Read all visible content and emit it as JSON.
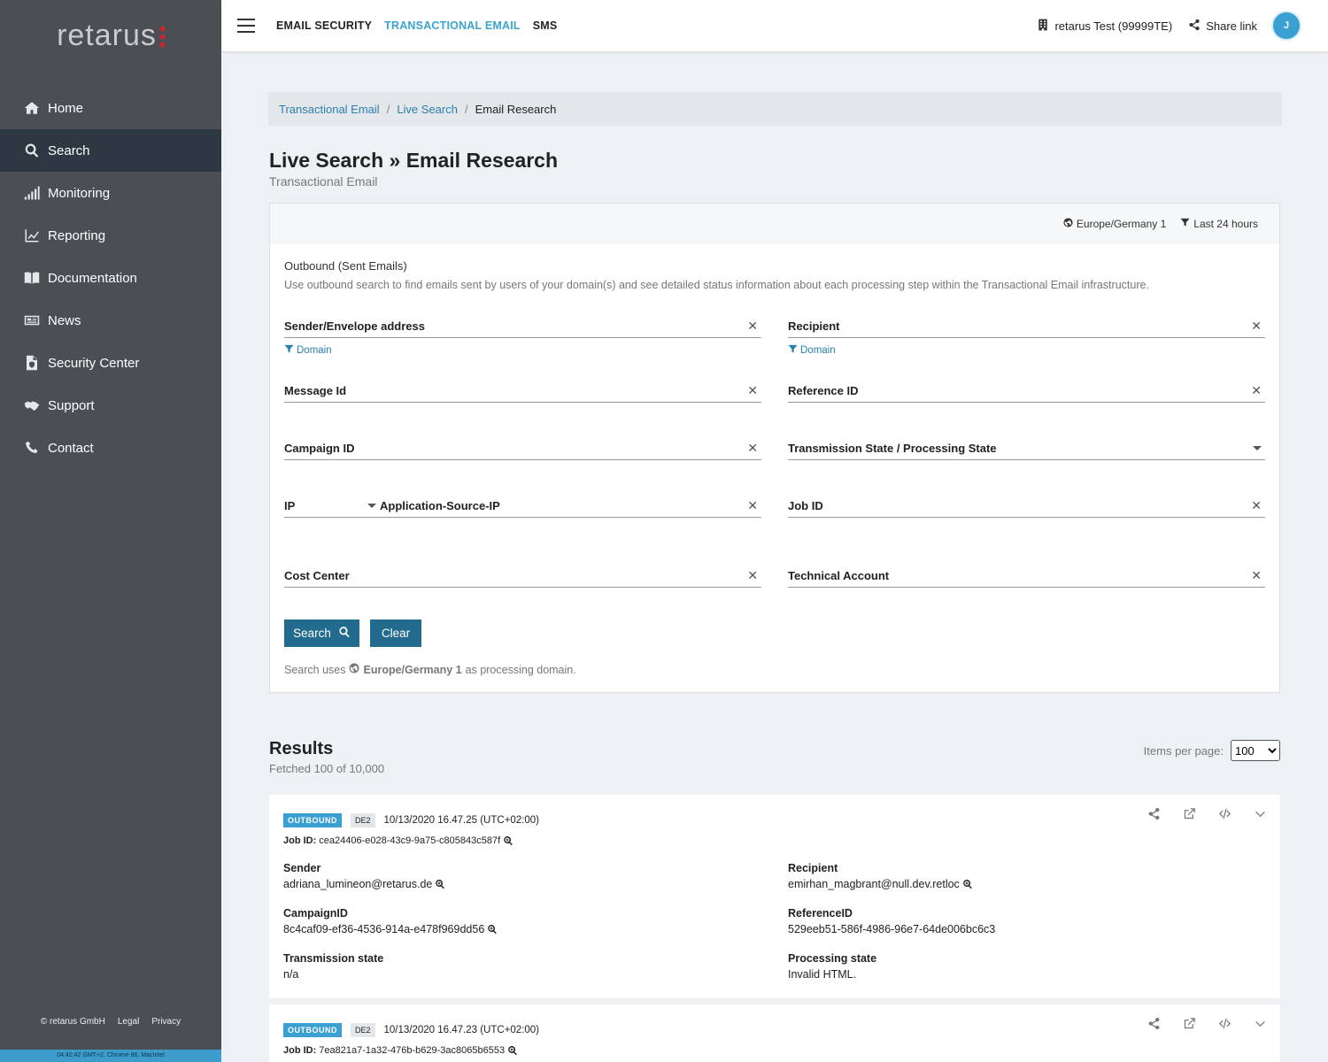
{
  "sidebar": {
    "logo": "retarus",
    "items": [
      {
        "label": "Home",
        "icon": "home-icon"
      },
      {
        "label": "Search",
        "icon": "search-icon"
      },
      {
        "label": "Monitoring",
        "icon": "signal-bars-icon"
      },
      {
        "label": "Reporting",
        "icon": "line-chart-icon"
      },
      {
        "label": "Documentation",
        "icon": "book-icon"
      },
      {
        "label": "News",
        "icon": "newspaper-icon"
      },
      {
        "label": "Security Center",
        "icon": "file-shield-icon"
      },
      {
        "label": "Support",
        "icon": "handshake-icon"
      },
      {
        "label": "Contact",
        "icon": "phone-icon"
      }
    ],
    "active_index": 1,
    "footer": {
      "copyright": "© retarus GmbH",
      "legal": "Legal",
      "privacy": "Privacy"
    },
    "status": "04:42:42 GMT+2, Chrome 86, MacIntel"
  },
  "topbar": {
    "tabs": [
      "EMAIL SECURITY",
      "TRANSACTIONAL EMAIL",
      "SMS"
    ],
    "active_tab": 1,
    "account": "retarus Test (99999TE)",
    "share": "Share link",
    "avatar": "J"
  },
  "breadcrumb": {
    "items": [
      "Transactional Email",
      "Live Search"
    ],
    "current": "Email Research"
  },
  "page": {
    "title": "Live Search » Email Research",
    "subtitle": "Transactional Email"
  },
  "panel": {
    "region": "Europe/Germany 1",
    "timeframe": "Last 24 hours",
    "section_title": "Outbound (Sent Emails)",
    "section_desc": "Use outbound search to find emails sent by users of your domain(s) and see detailed status information about each processing step within the Transactional Email infrastructure.",
    "fields": {
      "sender": "Sender/Envelope address",
      "recipient": "Recipient",
      "domain": "Domain",
      "message_id": "Message Id",
      "reference_id": "Reference ID",
      "campaign_id": "Campaign ID",
      "transmission_state": "Transmission State / Processing State",
      "ip": "IP",
      "ip_type": "Application-Source-IP",
      "job_id": "Job ID",
      "cost_center": "Cost Center",
      "technical_account": "Technical Account"
    },
    "search_btn": "Search",
    "clear_btn": "Clear",
    "note_prefix": "Search uses",
    "note_domain": "Europe/Germany 1",
    "note_suffix": "as processing domain."
  },
  "results": {
    "title": "Results",
    "subtitle": "Fetched 100 of 10,000",
    "ipp_label": "Items per page:",
    "ipp_value": "100",
    "items": [
      {
        "direction": "OUTBOUND",
        "region": "DE2",
        "timestamp": "10/13/2020 16.47.25 (UTC+02:00)",
        "job_label": "Job ID:",
        "job_id": "cea24406-e028-43c9-9a75-c805843c587f",
        "sender_label": "Sender",
        "sender": "adriana_lumineon@retarus.de",
        "recipient_label": "Recipient",
        "recipient": "emirhan_magbrant@null.dev.retloc",
        "campaign_label": "CampaignID",
        "campaign": "8c4caf09-ef36-4536-914a-e478f969dd56",
        "reference_label": "ReferenceID",
        "reference": "529eeb51-586f-4986-96e7-64de006bc6c3",
        "transmission_label": "Transmission state",
        "transmission": "n/a",
        "processing_label": "Processing state",
        "processing": "Invalid HTML."
      },
      {
        "direction": "OUTBOUND",
        "region": "DE2",
        "timestamp": "10/13/2020 16.47.23 (UTC+02:00)",
        "job_label": "Job ID:",
        "job_id": "7ea821a7-1a32-476b-b629-3ac8065b6553"
      }
    ]
  },
  "colors": {
    "sidebar": "#4b4e53",
    "sidebar_active": "#2e3843",
    "accent": "#3aa3d0",
    "button": "#236b8e",
    "link": "#2a7fae"
  }
}
